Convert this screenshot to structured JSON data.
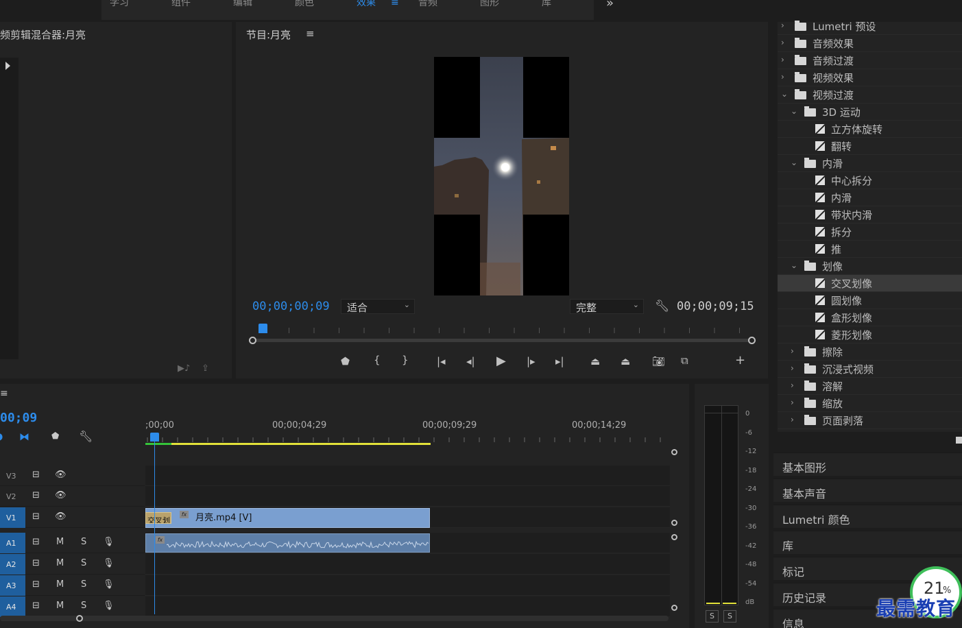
{
  "workspace_tabs": [
    "学习",
    "组件",
    "编辑",
    "颜色",
    "效果",
    "音频",
    "图形",
    "库"
  ],
  "active_tab": "效果",
  "more_glyph": "»",
  "source_panel": {
    "title": "频剪辑混合器:月亮"
  },
  "program": {
    "title": "节目:月亮",
    "current_time": "00;00;00;09",
    "fit": "适合",
    "quality": "完整",
    "duration": "00;00;09;15"
  },
  "effects_tree": [
    {
      "label": "Lumetri 预设",
      "level": 0,
      "type": "folder",
      "open": false
    },
    {
      "label": "音频效果",
      "level": 0,
      "type": "folder",
      "open": false
    },
    {
      "label": "音频过渡",
      "level": 0,
      "type": "folder",
      "open": false
    },
    {
      "label": "视频效果",
      "level": 0,
      "type": "folder",
      "open": false
    },
    {
      "label": "视频过渡",
      "level": 0,
      "type": "folder",
      "open": true
    },
    {
      "label": "3D 运动",
      "level": 1,
      "type": "folder",
      "open": true
    },
    {
      "label": "立方体旋转",
      "level": 2,
      "type": "effect"
    },
    {
      "label": "翻转",
      "level": 2,
      "type": "effect"
    },
    {
      "label": "内滑",
      "level": 1,
      "type": "folder",
      "open": true
    },
    {
      "label": "中心拆分",
      "level": 2,
      "type": "effect"
    },
    {
      "label": "内滑",
      "level": 2,
      "type": "effect"
    },
    {
      "label": "带状内滑",
      "level": 2,
      "type": "effect"
    },
    {
      "label": "拆分",
      "level": 2,
      "type": "effect"
    },
    {
      "label": "推",
      "level": 2,
      "type": "effect"
    },
    {
      "label": "划像",
      "level": 1,
      "type": "folder",
      "open": true
    },
    {
      "label": "交叉划像",
      "level": 2,
      "type": "effect",
      "selected": true
    },
    {
      "label": "圆划像",
      "level": 2,
      "type": "effect"
    },
    {
      "label": "盒形划像",
      "level": 2,
      "type": "effect"
    },
    {
      "label": "菱形划像",
      "level": 2,
      "type": "effect"
    },
    {
      "label": "擦除",
      "level": 1,
      "type": "folder",
      "open": false
    },
    {
      "label": "沉浸式视频",
      "level": 1,
      "type": "folder",
      "open": false
    },
    {
      "label": "溶解",
      "level": 1,
      "type": "folder",
      "open": false
    },
    {
      "label": "缩放",
      "level": 1,
      "type": "folder",
      "open": false
    },
    {
      "label": "页面剥落",
      "level": 1,
      "type": "folder",
      "open": false
    }
  ],
  "side_panels": [
    "基本图形",
    "基本声音",
    "Lumetri 颜色",
    "库",
    "标记",
    "历史记录",
    "信息"
  ],
  "timeline": {
    "current_time": "00;09",
    "ruler_labels": [
      ";00;00",
      "00;00;04;29",
      "00;00;09;29",
      "00;00;14;29"
    ],
    "tracks": [
      {
        "name": "V3",
        "kind": "video"
      },
      {
        "name": "V2",
        "kind": "video"
      },
      {
        "name": "V1",
        "kind": "video"
      },
      {
        "name": "A1",
        "kind": "audio"
      },
      {
        "name": "A2",
        "kind": "audio"
      },
      {
        "name": "A3",
        "kind": "audio"
      },
      {
        "name": "A4",
        "kind": "audio"
      }
    ],
    "audio_m": "M",
    "audio_s": "S",
    "video_clip": "月亮.mp4 [V]",
    "transition_label": "交叉划",
    "fx_badge": "fx"
  },
  "meter": {
    "db_labels": [
      "0",
      "-6",
      "-12",
      "-18",
      "-24",
      "-30",
      "-36",
      "-42",
      "-48",
      "-54",
      "dB"
    ],
    "solo": [
      "S",
      "S"
    ]
  },
  "progress_badge": {
    "value": "21",
    "unit": "%"
  },
  "watermark": "最需教育",
  "colors": {
    "accent": "#2d8ceb",
    "clip_video": "#7a9fd0",
    "clip_audio": "#5e7fa8",
    "work_area": "#e3e23a"
  }
}
